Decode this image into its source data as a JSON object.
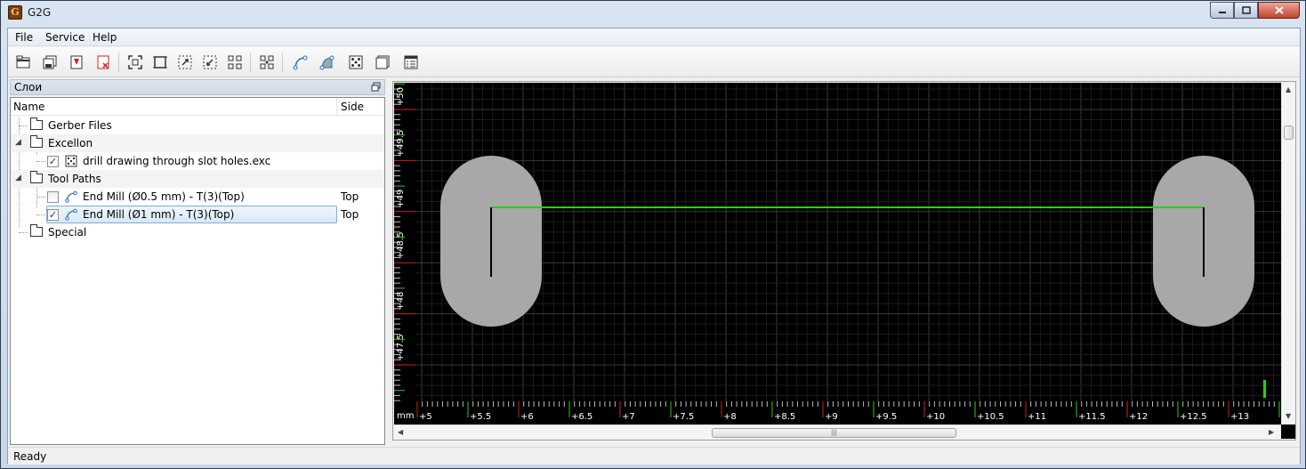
{
  "window": {
    "title": "G2G"
  },
  "menu": {
    "file": "File",
    "service": "Service",
    "help": "Help"
  },
  "toolbar": {
    "icons": [
      "open-icon",
      "save-icon",
      "export-pdf-icon",
      "close-file-icon",
      "zoom-fit-icon",
      "zoom-extents-icon",
      "zoom-selection-icon",
      "zoom-in-icon",
      "zoom-all-icon",
      "zoom-grid-icon",
      "toolpath-icon",
      "profile-icon",
      "drill-icon",
      "layer-icon",
      "settings-icon"
    ]
  },
  "panel": {
    "title": "Слои",
    "columns": {
      "name": "Name",
      "side": "Side"
    },
    "rows": [
      {
        "label": "Gerber Files",
        "side": ""
      },
      {
        "label": "Excellon",
        "side": ""
      },
      {
        "label": "drill drawing through slot holes.exc",
        "side": "",
        "checked": true
      },
      {
        "label": "Tool Paths",
        "side": ""
      },
      {
        "label": "End Mill (Ø0.5 mm) - T(3)(Top)",
        "side": "Top",
        "checked": false
      },
      {
        "label": "End Mill (Ø1 mm) - T(3)(Top)",
        "side": "Top",
        "checked": true
      },
      {
        "label": "Special",
        "side": ""
      }
    ]
  },
  "view": {
    "unit": "mm",
    "x_ticks": [
      "+5",
      "+5.5",
      "+6",
      "+6.5",
      "+7",
      "+7.5",
      "+8",
      "+8.5",
      "+9",
      "+9.5",
      "+10",
      "+10.5",
      "+11",
      "+11.5",
      "+12",
      "+12.5",
      "+13"
    ],
    "y_ticks": [
      "+50",
      "+49.5",
      "+49",
      "+48.5",
      "+48",
      "+47.5"
    ],
    "colors": {
      "background": "#000000",
      "pad": "#a8a8a8",
      "path": "#2ecc1a",
      "grid": "#2a2a2a"
    }
  },
  "status": {
    "text": "Ready"
  }
}
